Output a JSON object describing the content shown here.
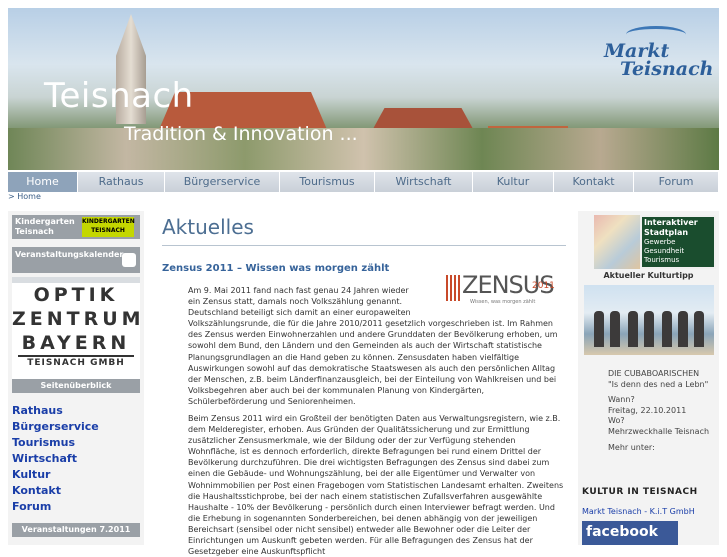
{
  "header": {
    "title": "Teisnach",
    "subtitle": "Tradition & Innovation ...",
    "logo_line1": "Markt",
    "logo_line2": "Teisnach"
  },
  "nav": [
    "Home",
    "Rathaus",
    "Bürgerservice",
    "Tourismus",
    "Wirtschaft",
    "Kultur",
    "Kontakt",
    "Forum"
  ],
  "nav_active": "Home",
  "breadcrumb": "> Home",
  "left": {
    "kindergarten_label": "Kindergarten Teisnach",
    "kindergarten_badge": "KINDERGARTEN TEISNACH",
    "veranstaltungskalender": "Veranstaltungskalender",
    "optik_lines": [
      "OPTIK",
      "ZENTRUM",
      "BAYERN"
    ],
    "optik_sub": "TEISNACH GMBH",
    "seitenueberblick": "Seitenüberblick",
    "links": [
      "Rathaus",
      "Bürgerservice",
      "Tourismus",
      "Wirtschaft",
      "Kultur",
      "Kontakt",
      "Forum"
    ],
    "veranstaltungen": "Veranstaltungen 7.2011"
  },
  "main": {
    "heading": "Aktuelles",
    "article_title": "Zensus 2011 – Wissen was morgen zählt",
    "zensus_word": "ZENSUS",
    "zensus_year": "2011",
    "zensus_slogan": "Wissen, was morgen zählt",
    "para1": "Am 9. Mai 2011 fand nach fast genau 24 Jahren wieder ein Zensus statt, damals noch Volkszählung genannt. Deutschland beteiligt sich damit an einer europaweiten Volkszählungsrunde, die für die Jahre 2010/2011 gesetzlich vorgeschrieben ist. Im Rahmen des Zensus werden Einwohnerzahlen und andere Grunddaten der Bevölkerung erhoben, um sowohl dem Bund, den Ländern und den Gemeinden als auch der Wirtschaft statistische Planungsgrundlagen an die Hand geben zu können. Zensusdaten haben vielfältige Auswirkungen sowohl auf das demokratische Staatswesen als auch den persönlichen Alltag der Menschen, z.B. beim Länderfinanzausgleich, bei der Einteilung von Wahlkreisen und bei Volksbegehren aber auch bei der kommunalen Planung von Kindergärten, Schülerbeförderung und Seniorenheimen.",
    "para2": "Beim Zensus 2011 wird ein Großteil der benötigten Daten aus Verwaltungsregistern, wie z.B. dem Melderegister, erhoben. Aus Gründen der Qualitätssicherung und zur Ermittlung zusätzlicher Zensusmerkmale, wie der Bildung oder der zur Verfügung stehenden Wohnfläche, ist es dennoch erforderlich, direkte Befragungen bei rund einem Drittel der Bevölkerung durchzuführen. Die drei wichtigsten Befragungen des Zensus sind dabei zum einen die Gebäude- und Wohnungszählung, bei der alle Eigentümer und Verwalter von Wohnimmobilien per Post einen Fragebogen vom Statistischen Landesamt erhalten. Zweitens die Haushaltsstichprobe, bei der nach einem statistischen Zufallsverfahren ausgewählte Haushalte - 10% der Bevölkerung - persönlich durch einen Interviewer befragt werden. Und die Erhebung in sogenannten Sonderbereichen, bei denen abhängig von der jeweiligen Bereichsart (sensibel oder nicht sensibel) entweder alle Bewohner oder die Leiter der Einrichtungen um Auskunft gebeten werden. Für alle Befragungen des Zensus hat der Gesetzgeber eine Auskunftspflicht"
  },
  "right": {
    "stadtplan_title": "Interaktiver Stadtplan",
    "stadtplan_sub": "Gewerbe Gesundheit Tourismus",
    "kulturtipp": "Aktueller Kulturtipp",
    "event_title": "DIE CUBABOARISCHEN",
    "event_quote": "\"Is denn des ned a Lebn\"",
    "wann_label": "Wann?",
    "wann_value": "Freitag, 22.10.2011",
    "wo_label": "Wo?",
    "wo_value": "Mehrzweckhalle Teisnach",
    "mehr": "Mehr unter:",
    "kultur_logo": "KULTUR IN TEISNACH",
    "kit_link": "Markt Teisnach - K.i.T GmbH",
    "facebook": "facebook"
  }
}
